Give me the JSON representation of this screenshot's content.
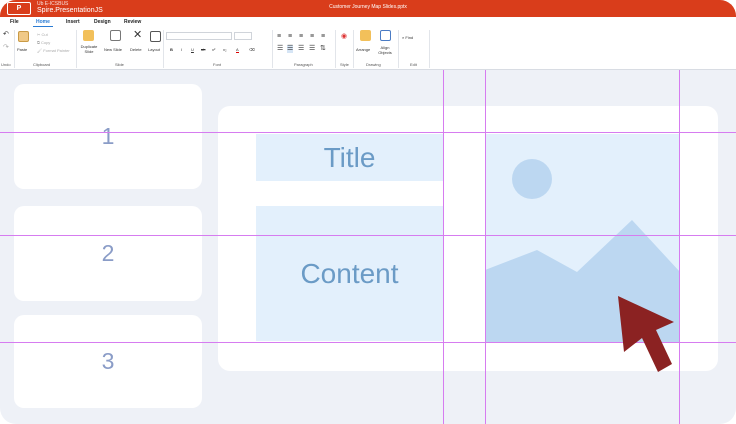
{
  "titlebar": {
    "logo_text": "P",
    "brand_top": "Ub E-ICSBUS",
    "brand": "Spire.PresentationJS",
    "doc_title": "Customer Journey Map Slides.pptx"
  },
  "menus": [
    "File",
    "Home",
    "Insert",
    "Design",
    "Review"
  ],
  "active_menu": "Home",
  "ribbon": {
    "undo_label": "Undo",
    "paste_label": "Paste",
    "cut_label": "Cut",
    "copy_label": "Copy",
    "format_painter_label": "Format Painter",
    "clipboard_label": "Clipboard",
    "duplicate_slide_label": "Duplicate Slide",
    "new_slide_label": "New Slide",
    "delete_label": "Delete",
    "layout_label": "Layout",
    "slide_group_label": "Slide",
    "font_group_label": "Font",
    "paragraph_group_label": "Paragraph",
    "style_group_label": "Style",
    "arrange_label": "Arrange",
    "align_objects_label": "Align Objects",
    "drawing_group_label": "Drawing",
    "find_label": "Find",
    "edit_group_label": "Edit"
  },
  "thumbnails": [
    "1",
    "2",
    "3"
  ],
  "slide": {
    "title_placeholder": "Title",
    "content_placeholder": "Content"
  },
  "colors": {
    "titlebar": "#d93d1b",
    "accent": "#2a7bd3",
    "guide": "#d67cf0",
    "placeholder": "#e3f0fc",
    "cursor": "#8b2222"
  }
}
